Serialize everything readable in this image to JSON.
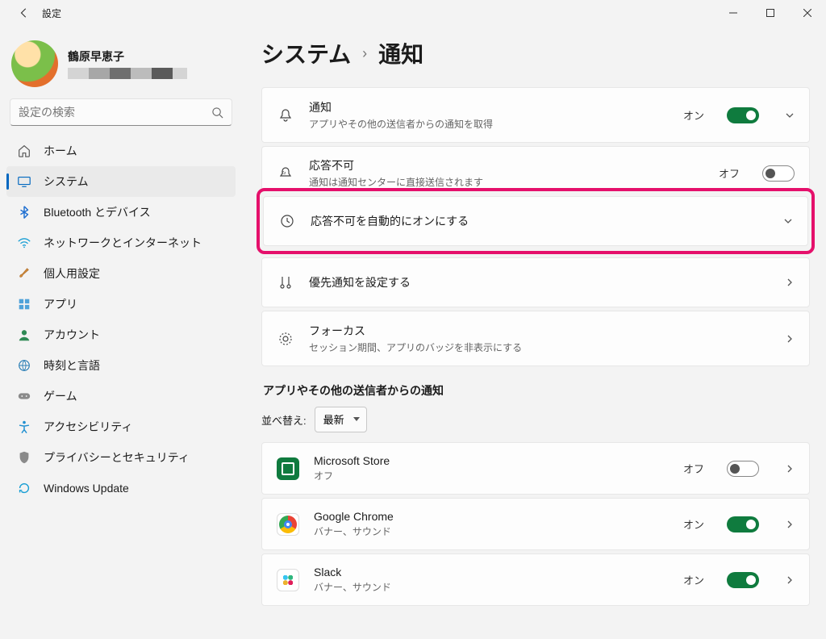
{
  "window": {
    "app_title": "設定"
  },
  "profile": {
    "name": "鶴原早恵子"
  },
  "search": {
    "placeholder": "設定の検索"
  },
  "nav": {
    "home": "ホーム",
    "system": "システム",
    "bluetooth": "Bluetooth とデバイス",
    "network": "ネットワークとインターネット",
    "personalization": "個人用設定",
    "apps": "アプリ",
    "accounts": "アカウント",
    "timelang": "時刻と言語",
    "gaming": "ゲーム",
    "accessibility": "アクセシビリティ",
    "privacy": "プライバシーとセキュリティ",
    "update": "Windows Update"
  },
  "breadcrumb": {
    "parent": "システム",
    "current": "通知"
  },
  "cards": {
    "notif": {
      "title": "通知",
      "sub": "アプリやその他の送信者からの通知を取得",
      "state": "オン"
    },
    "dnd": {
      "title": "応答不可",
      "sub": "通知は通知センターに直接送信されます",
      "state": "オフ"
    },
    "auto_dnd": {
      "title": "応答不可を自動的にオンにする"
    },
    "priority": {
      "title": "優先通知を設定する"
    },
    "focus": {
      "title": "フォーカス",
      "sub": "セッション期間、アプリのバッジを非表示にする"
    }
  },
  "apps_section": {
    "heading": "アプリやその他の送信者からの通知",
    "sort_label": "並べ替え:",
    "sort_value": "最新"
  },
  "applist": {
    "ms": {
      "name": "Microsoft Store",
      "sub": "オフ",
      "state": "オフ"
    },
    "gc": {
      "name": "Google Chrome",
      "sub": "バナー、サウンド",
      "state": "オン"
    },
    "sl": {
      "name": "Slack",
      "sub": "バナー、サウンド",
      "state": "オン"
    }
  }
}
